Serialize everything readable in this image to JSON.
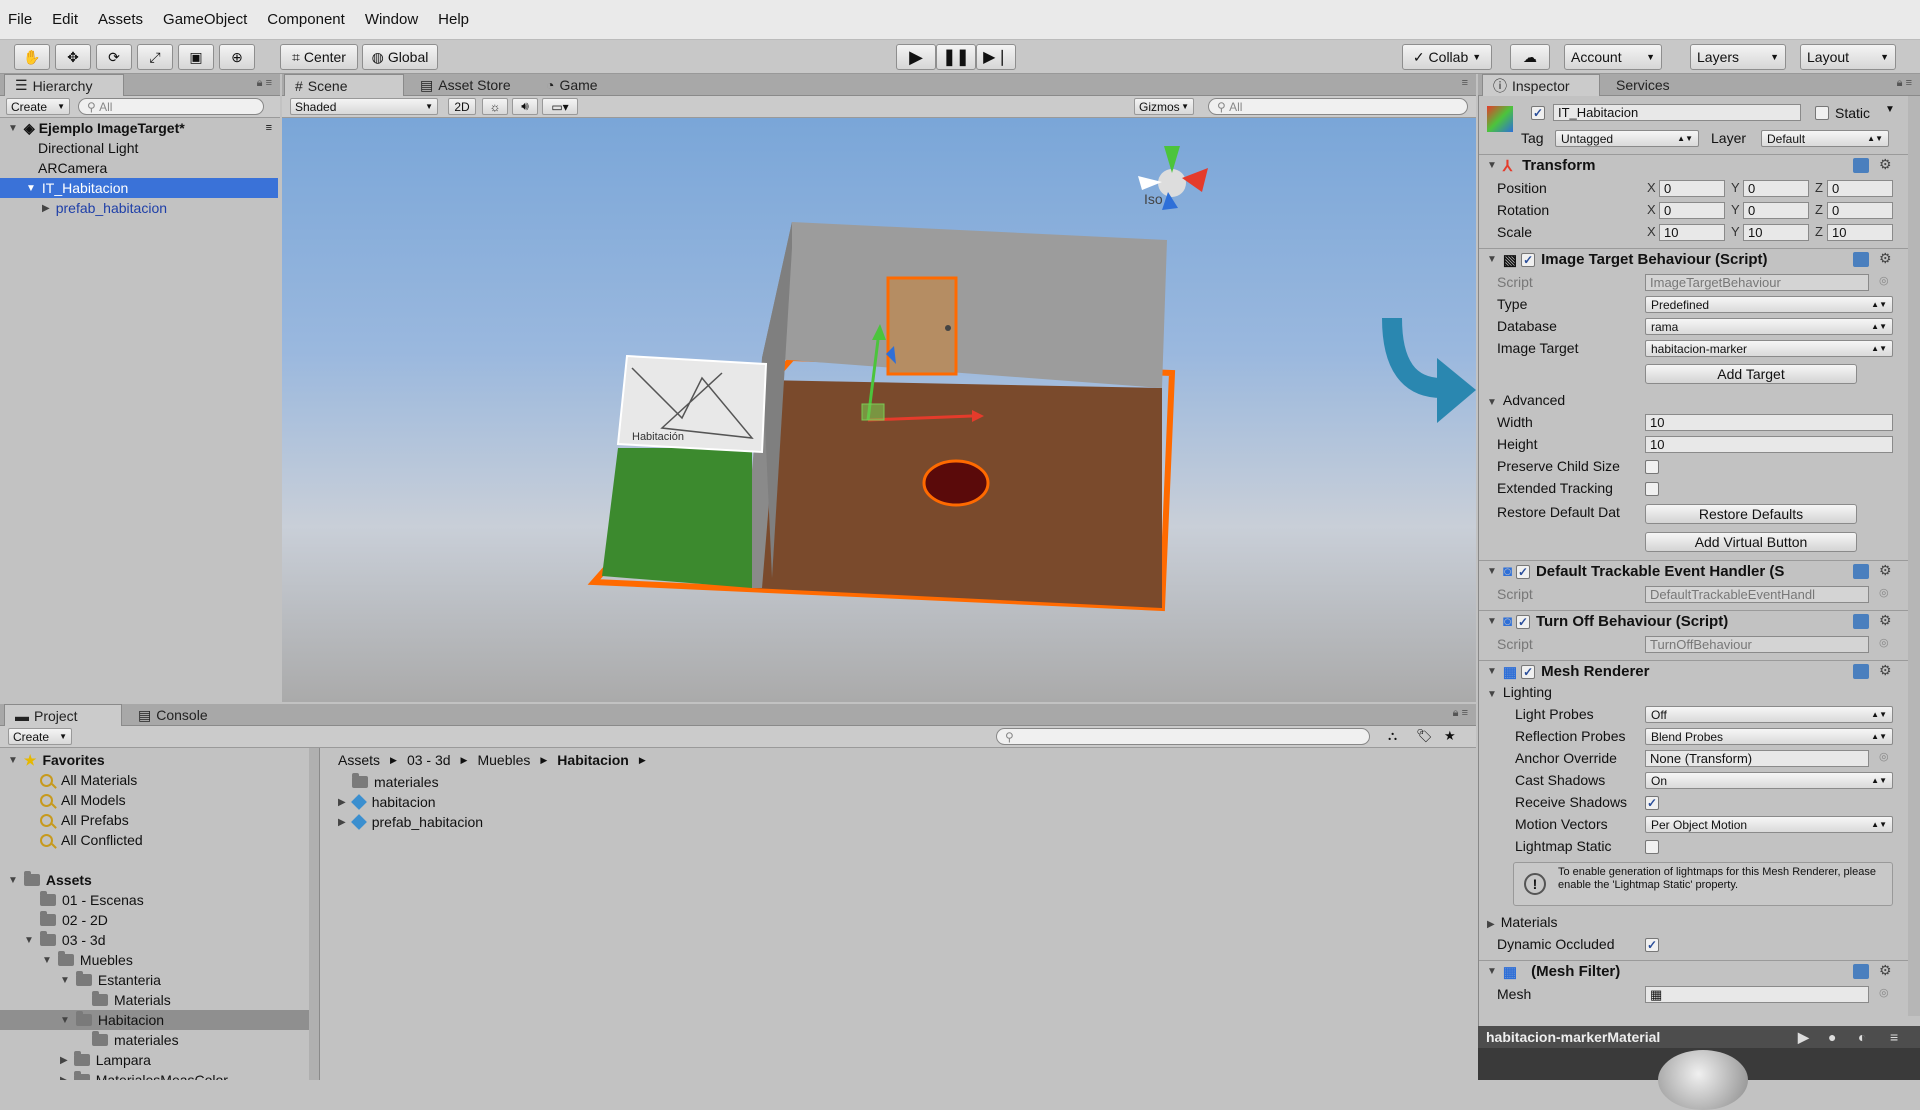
{
  "menu": [
    "File",
    "Edit",
    "Assets",
    "GameObject",
    "Component",
    "Window",
    "Help"
  ],
  "toolbar": {
    "center": "Center",
    "global": "Global",
    "collab": "Collab",
    "account": "Account",
    "layers": "Layers",
    "layout": "Layout"
  },
  "hierarchy": {
    "tab": "Hierarchy",
    "create": "Create",
    "search": "All",
    "scene": "Ejemplo ImageTarget*",
    "items": [
      "Directional Light",
      "ARCamera",
      "IT_Habitacion",
      "prefab_habitacion"
    ]
  },
  "scene": {
    "tabs": [
      "Scene",
      "Asset Store",
      "Game"
    ],
    "shading": "Shaded",
    "mode2d": "2D",
    "gizmos": "Gizmos",
    "search": "All",
    "iso": "Iso",
    "poster_text": "Habitación"
  },
  "project": {
    "tabs": [
      "Project",
      "Console"
    ],
    "create": "Create",
    "favorites_label": "Favorites",
    "favorites": [
      "All Materials",
      "All Models",
      "All Prefabs",
      "All Conflicted"
    ],
    "assets_label": "Assets",
    "folders": [
      "01 - Escenas",
      "02 - 2D",
      "03 - 3d",
      "Muebles",
      "Estanteria",
      "Materials",
      "Habitacion",
      "materiales",
      "Lampara",
      "MaterialesMeasColor"
    ],
    "breadcrumb": [
      "Assets",
      "03 - 3d",
      "Muebles",
      "Habitacion"
    ],
    "contents": [
      "materiales",
      "habitacion",
      "prefab_habitacion"
    ]
  },
  "inspector": {
    "tabs": [
      "Inspector",
      "Services"
    ],
    "object_name": "IT_Habitacion",
    "static": "Static",
    "tag_label": "Tag",
    "tag": "Untagged",
    "layer_label": "Layer",
    "layer": "Default",
    "transform": {
      "title": "Transform",
      "position": "Position",
      "rotation": "Rotation",
      "scale": "Scale",
      "pos": [
        "0",
        "0",
        "0"
      ],
      "rot": [
        "0",
        "0",
        "0"
      ],
      "scl": [
        "10",
        "10",
        "10"
      ]
    },
    "itb": {
      "title": "Image Target Behaviour (Script)",
      "script_label": "Script",
      "script": "ImageTargetBehaviour",
      "type_label": "Type",
      "type": "Predefined",
      "db_label": "Database",
      "db": "rama",
      "it_label": "Image Target",
      "it": "habitacion-marker",
      "add_target": "Add Target",
      "advanced": "Advanced",
      "width_label": "Width",
      "width": "10",
      "height_label": "Height",
      "height": "10",
      "pcs": "Preserve Child Size",
      "ext": "Extended Tracking",
      "rdd": "Restore Default Dat",
      "restore": "Restore Defaults",
      "avb": "Add Virtual Button"
    },
    "dteh": {
      "title": "Default Trackable Event Handler (S",
      "script_label": "Script",
      "script": "DefaultTrackableEventHandl"
    },
    "tob": {
      "title": "Turn Off Behaviour (Script)",
      "script_label": "Script",
      "script": "TurnOffBehaviour"
    },
    "mr": {
      "title": "Mesh Renderer",
      "lighting": "Lighting",
      "lp_label": "Light Probes",
      "lp": "Off",
      "rp_label": "Reflection Probes",
      "rp": "Blend Probes",
      "ao_label": "Anchor Override",
      "ao": "None (Transform)",
      "cs_label": "Cast Shadows",
      "cs": "On",
      "rs_label": "Receive Shadows",
      "mv_label": "Motion Vectors",
      "mv": "Per Object Motion",
      "ls_label": "Lightmap Static",
      "note": "To enable generation of lightmaps for this Mesh Renderer, please enable the 'Lightmap Static' property.",
      "materials": "Materials",
      "do_label": "Dynamic Occluded"
    },
    "mf": {
      "title": "(Mesh Filter)",
      "mesh_label": "Mesh"
    },
    "preview": "habitacion-markerMaterial"
  }
}
